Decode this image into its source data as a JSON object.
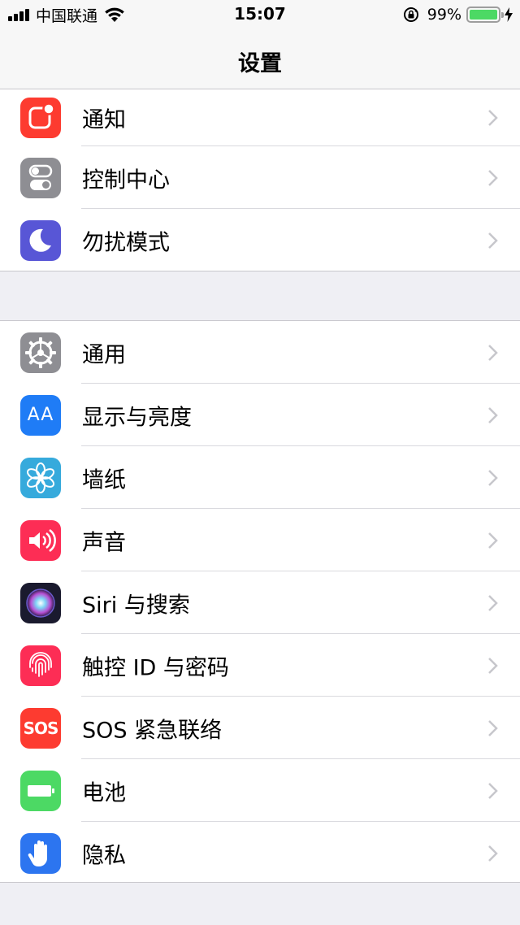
{
  "status_bar": {
    "carrier": "中国联通",
    "time": "15:07",
    "battery_percent": "99%",
    "battery_level": 0.99,
    "icons": [
      "signal-icon",
      "wifi-icon",
      "rotation-lock-icon",
      "battery-icon",
      "charging-icon"
    ]
  },
  "nav": {
    "title": "设置"
  },
  "groups": [
    {
      "items": [
        {
          "label": "通知",
          "icon": "notifications-icon",
          "color": "#fd3b30"
        },
        {
          "label": "控制中心",
          "icon": "control-center-icon",
          "color": "#8e8e93"
        },
        {
          "label": "勿扰模式",
          "icon": "moon-icon",
          "color": "#5856d6"
        }
      ]
    },
    {
      "items": [
        {
          "label": "通用",
          "icon": "gear-icon",
          "color": "#8e8e93"
        },
        {
          "label": "显示与亮度",
          "icon": "display-brightness-icon",
          "icon_text": "AA",
          "color": "#1f7cf6"
        },
        {
          "label": "墙纸",
          "icon": "wallpaper-flower-icon",
          "color": "#36aadc"
        },
        {
          "label": "声音",
          "icon": "speaker-icon",
          "color": "#fd2d55"
        },
        {
          "label": "Siri 与搜索",
          "icon": "siri-icon",
          "color": "#1a1a2e"
        },
        {
          "label": "触控 ID 与密码",
          "icon": "fingerprint-icon",
          "color": "#fd2d55"
        },
        {
          "label": "SOS 紧急联络",
          "icon": "sos-icon",
          "icon_text": "SOS",
          "color": "#fd3b30"
        },
        {
          "label": "电池",
          "icon": "battery-setting-icon",
          "color": "#4cd964"
        },
        {
          "label": "隐私",
          "icon": "hand-icon",
          "color": "#2c75f0"
        }
      ]
    }
  ]
}
